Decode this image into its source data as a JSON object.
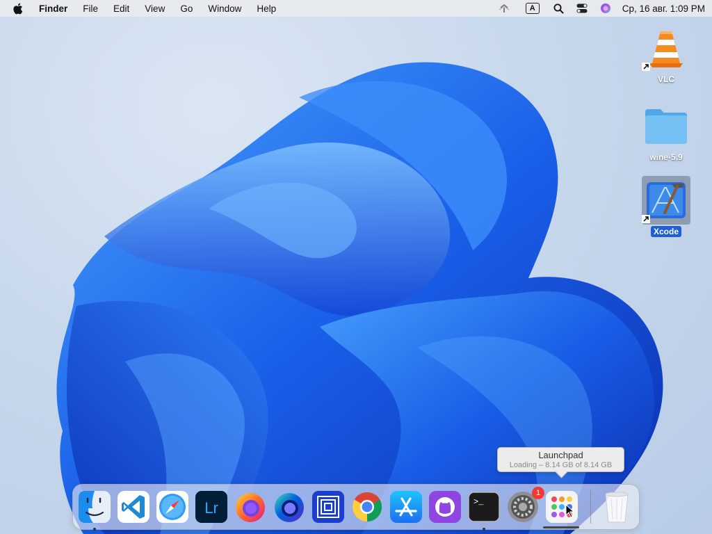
{
  "menubar": {
    "apple_icon": "apple-logo-icon",
    "app_name": "Finder",
    "menus": [
      "File",
      "Edit",
      "View",
      "Go",
      "Window",
      "Help"
    ],
    "status_icons": [
      "wifi-icon",
      "input-source-icon",
      "spotlight-search-icon",
      "control-center-icon",
      "siri-icon"
    ],
    "input_source": "A",
    "clock": "Ср, 16 авг.  1:09 PM"
  },
  "desktop": {
    "icons": [
      {
        "label": "VLC",
        "icon": "vlc-cone-icon",
        "alias": true,
        "selected": false
      },
      {
        "label": "wine-5.9",
        "icon": "folder-icon",
        "alias": false,
        "selected": false
      },
      {
        "label": "Xcode",
        "icon": "xcode-icon",
        "alias": true,
        "selected": true
      }
    ]
  },
  "tooltip": {
    "title": "Launchpad",
    "subtitle": "Loading – 8.14 GB of 8.14 GB"
  },
  "dock": {
    "apps": [
      {
        "name": "Finder",
        "icon": "finder-icon",
        "running": true
      },
      {
        "name": "Visual Studio Code",
        "icon": "vscode-icon",
        "running": false
      },
      {
        "name": "Safari",
        "icon": "safari-icon",
        "running": false
      },
      {
        "name": "Lightroom",
        "icon": "lightroom-icon",
        "text": "Lr",
        "running": false
      },
      {
        "name": "Firefox",
        "icon": "firefox-icon",
        "running": false
      },
      {
        "name": "Firefox Developer Edition",
        "icon": "firefox-dev-icon",
        "running": false
      },
      {
        "name": "Parallels",
        "icon": "parallels-icon",
        "running": false
      },
      {
        "name": "Chrome",
        "icon": "chrome-icon",
        "running": false
      },
      {
        "name": "App Store",
        "icon": "app-store-icon",
        "running": false
      },
      {
        "name": "GitHub Desktop",
        "icon": "github-icon",
        "running": false
      },
      {
        "name": "Terminal",
        "icon": "terminal-icon",
        "text": ">_",
        "running": true
      },
      {
        "name": "System Settings",
        "icon": "system-settings-icon",
        "badge": "1",
        "running": false
      },
      {
        "name": "Launchpad",
        "icon": "launchpad-icon",
        "running": false,
        "loading_progress": 1.0
      }
    ],
    "trash": {
      "name": "Trash",
      "icon": "trash-icon"
    }
  },
  "colors": {
    "wallpaper_blue": "#1f5fe6",
    "selection": "#1f5fd6",
    "badge": "#f23a33"
  }
}
